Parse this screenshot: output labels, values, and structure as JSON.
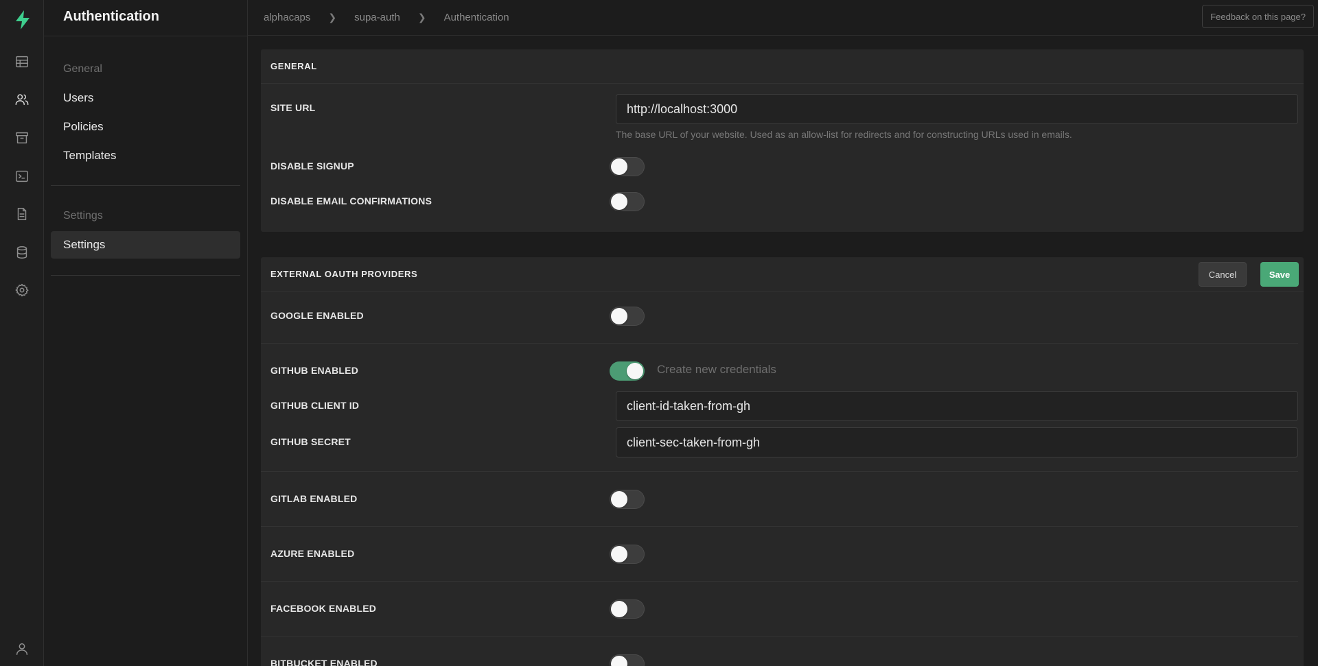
{
  "app": {
    "section_title": "Authentication"
  },
  "rail": {
    "icons": [
      "bolt-logo",
      "table-icon",
      "users-icon",
      "archive-icon",
      "terminal-icon",
      "document-icon",
      "database-icon",
      "gear-icon",
      "user-icon"
    ],
    "active": "users-icon",
    "accent": "#3ecf8e"
  },
  "subnav": {
    "general_label": "General",
    "items": [
      {
        "label": "Users"
      },
      {
        "label": "Policies"
      },
      {
        "label": "Templates"
      }
    ],
    "settings_label": "Settings",
    "settings_items": [
      {
        "label": "Settings"
      }
    ]
  },
  "topbar": {
    "breadcrumbs": [
      "alphacaps",
      "supa-auth",
      "Authentication"
    ],
    "feedback_label": "Feedback on this page?"
  },
  "general": {
    "heading": "GENERAL",
    "site_url_label": "SITE URL",
    "site_url_value": "http://localhost:3000",
    "site_url_help": "The base URL of your website. Used as an allow-list for redirects and for constructing URLs used in emails.",
    "disable_signup_label": "DISABLE SIGNUP",
    "disable_signup": false,
    "disable_email_conf_label": "DISABLE EMAIL CONFIRMATIONS",
    "disable_email_conf": false
  },
  "oauth": {
    "heading": "EXTERNAL OAUTH PROVIDERS",
    "cancel_label": "Cancel",
    "save_label": "Save",
    "google_label": "GOOGLE ENABLED",
    "google": false,
    "github_label": "GITHUB ENABLED",
    "github": true,
    "github_note": "Create new credentials",
    "github_client_id_label": "GITHUB CLIENT ID",
    "github_client_id_value": "client-id-taken-from-gh",
    "github_secret_label": "GITHUB SECRET",
    "github_secret_value": "client-sec-taken-from-gh",
    "gitlab_label": "GITLAB ENABLED",
    "gitlab": false,
    "azure_label": "AZURE ENABLED",
    "azure": false,
    "facebook_label": "FACEBOOK ENABLED",
    "facebook": false,
    "bitbucket_label": "BITBUCKET ENABLED",
    "bitbucket": false
  }
}
